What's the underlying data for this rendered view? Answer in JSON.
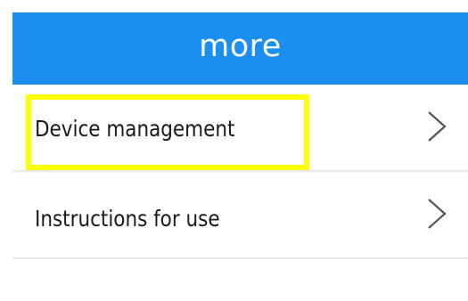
{
  "header": {
    "title": "more"
  },
  "menu": {
    "items": [
      {
        "label": "Device management",
        "icon": "chevron-right-icon"
      },
      {
        "label": "Instructions for use",
        "icon": "chevron-right-icon"
      }
    ]
  },
  "colors": {
    "header_background": "#1b8ff0",
    "highlight": "#ffff00",
    "divider": "#e9e9e9"
  }
}
